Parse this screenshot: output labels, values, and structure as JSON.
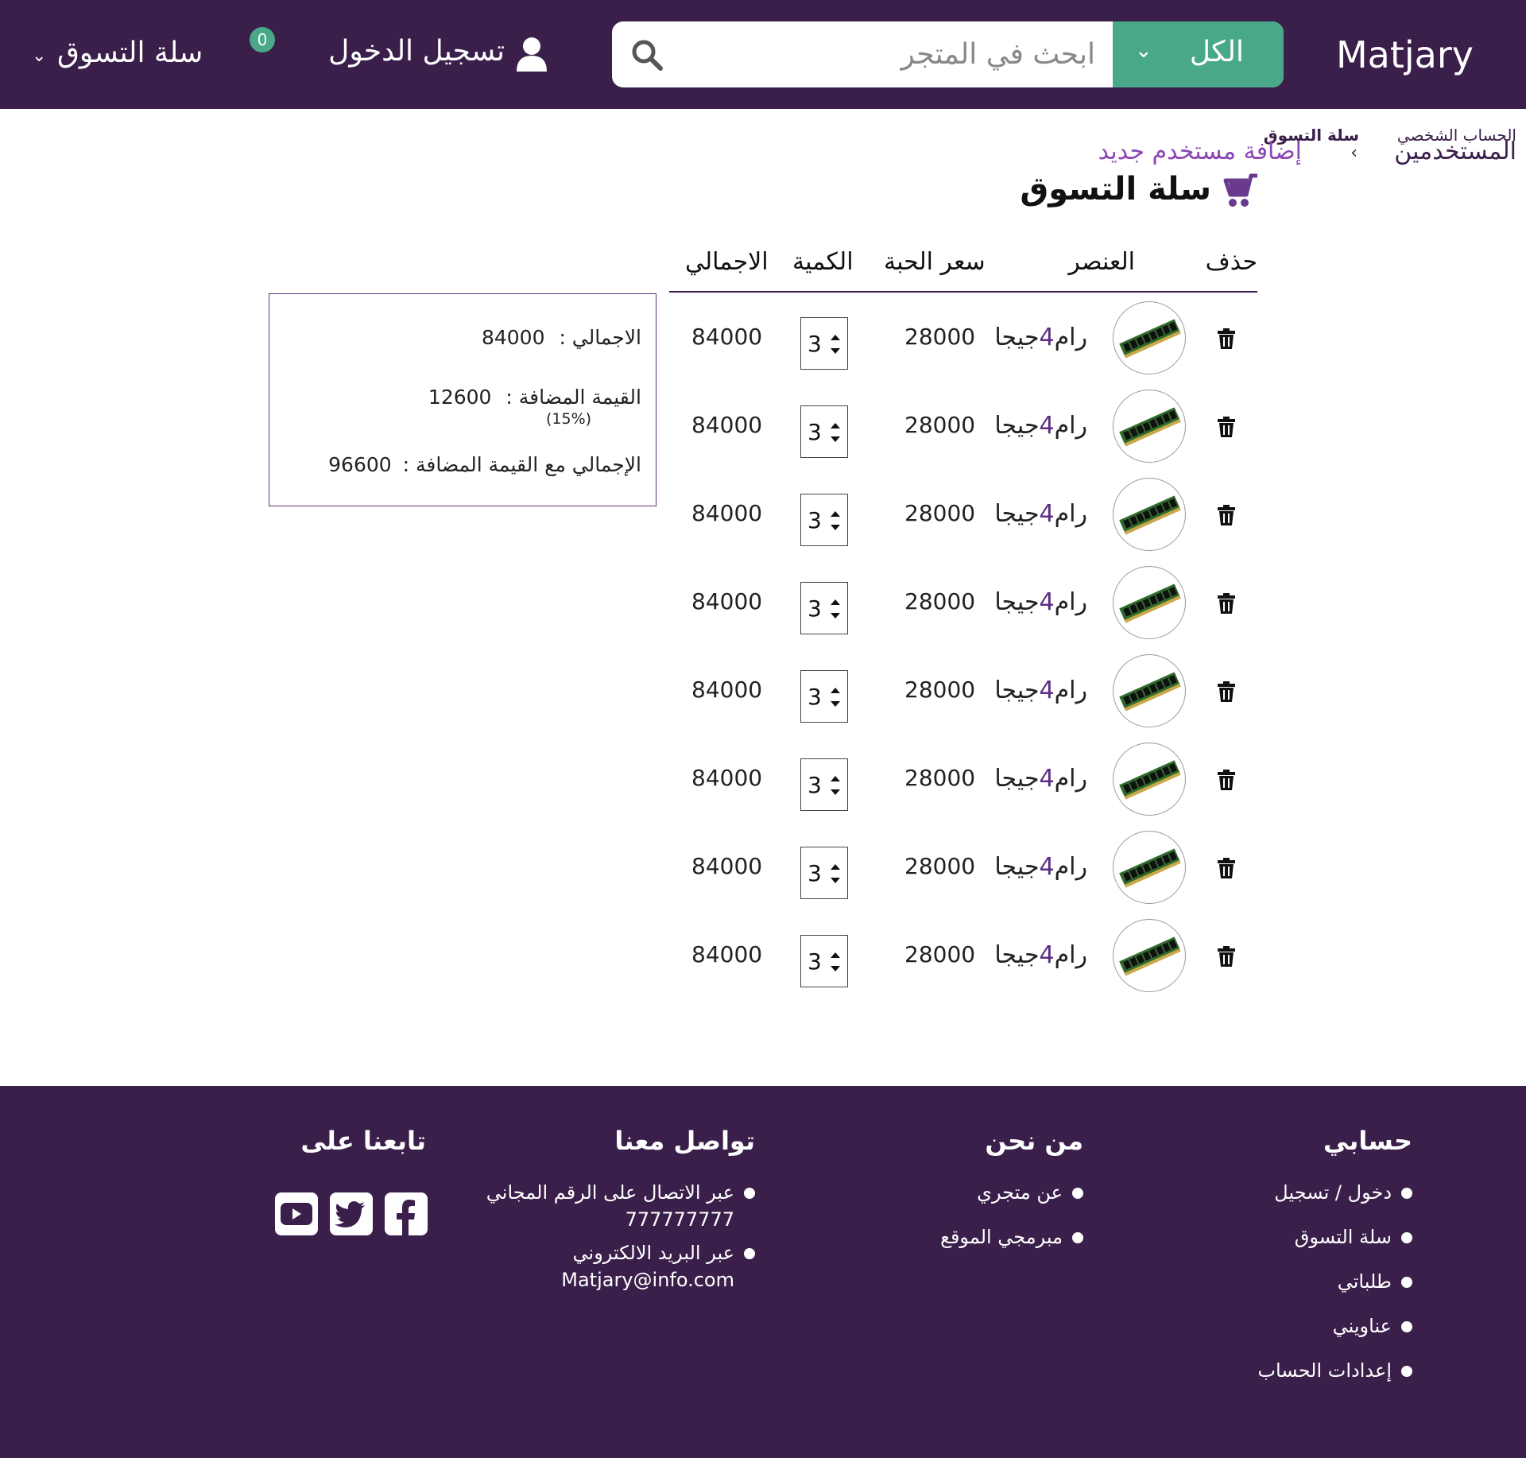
{
  "header": {
    "brand": "Matjary",
    "search_category": "الكل",
    "search_placeholder": "ابحث في المتجر",
    "login_label": "تسجيل الدخول",
    "cart_label": "سلة التسوق",
    "cart_count": "0"
  },
  "breadcrumb": {
    "top_1": "الحساب الشخصي",
    "top_2": "سلة التسوق",
    "item_1": "المستخدمين",
    "item_2": "إضافة مستخدم جديد",
    "separator": "‹"
  },
  "page_title": "سلة التسوق",
  "table": {
    "headers": {
      "delete": "حذف",
      "item": "العنصر",
      "unit_price": "سعر الحبة",
      "quantity": "الكمية",
      "total": "الاجمالي"
    },
    "rows": [
      {
        "name_prefix": "رام",
        "name_num": "4",
        "name_suffix": "جيجا",
        "price": "28000",
        "qty": "3",
        "total": "84000"
      },
      {
        "name_prefix": "رام",
        "name_num": "4",
        "name_suffix": "جيجا",
        "price": "28000",
        "qty": "3",
        "total": "84000"
      },
      {
        "name_prefix": "رام",
        "name_num": "4",
        "name_suffix": "جيجا",
        "price": "28000",
        "qty": "3",
        "total": "84000"
      },
      {
        "name_prefix": "رام",
        "name_num": "4",
        "name_suffix": "جيجا",
        "price": "28000",
        "qty": "3",
        "total": "84000"
      },
      {
        "name_prefix": "رام",
        "name_num": "4",
        "name_suffix": "جيجا",
        "price": "28000",
        "qty": "3",
        "total": "84000"
      },
      {
        "name_prefix": "رام",
        "name_num": "4",
        "name_suffix": "جيجا",
        "price": "28000",
        "qty": "3",
        "total": "84000"
      },
      {
        "name_prefix": "رام",
        "name_num": "4",
        "name_suffix": "جيجا",
        "price": "28000",
        "qty": "3",
        "total": "84000"
      },
      {
        "name_prefix": "رام",
        "name_num": "4",
        "name_suffix": "جيجا",
        "price": "28000",
        "qty": "3",
        "total": "84000"
      }
    ]
  },
  "summary": {
    "total_label": "الاجمالي :",
    "total_value": "84000",
    "vat_label": "القيمة المضافة :",
    "vat_value": "12600",
    "vat_rate": "(15%)",
    "grand_label": "الإجمالي مع القيمة المضافة :",
    "grand_value": "96600"
  },
  "footer": {
    "account": {
      "title": "حسابي",
      "links": [
        "دخول / تسجيل",
        "سلة التسوق",
        "طلباتي",
        "عناويني",
        "إعدادات الحساب"
      ]
    },
    "about": {
      "title": "من نحن",
      "links": [
        "عن متجري",
        "مبرمجي الموقع"
      ]
    },
    "contact": {
      "title": "تواصل معنا",
      "phone_label": "عبر الاتصال على الرقم المجاني",
      "phone": "777777777",
      "email_label": "عبر البريد الالكتروني",
      "email": "Matjary@info.com"
    },
    "follow": {
      "title": "تابعنا على"
    }
  },
  "colors": {
    "brand_purple": "#3a1f4b",
    "accent_green": "#4aa88a",
    "link_purple": "#8a48b4"
  }
}
